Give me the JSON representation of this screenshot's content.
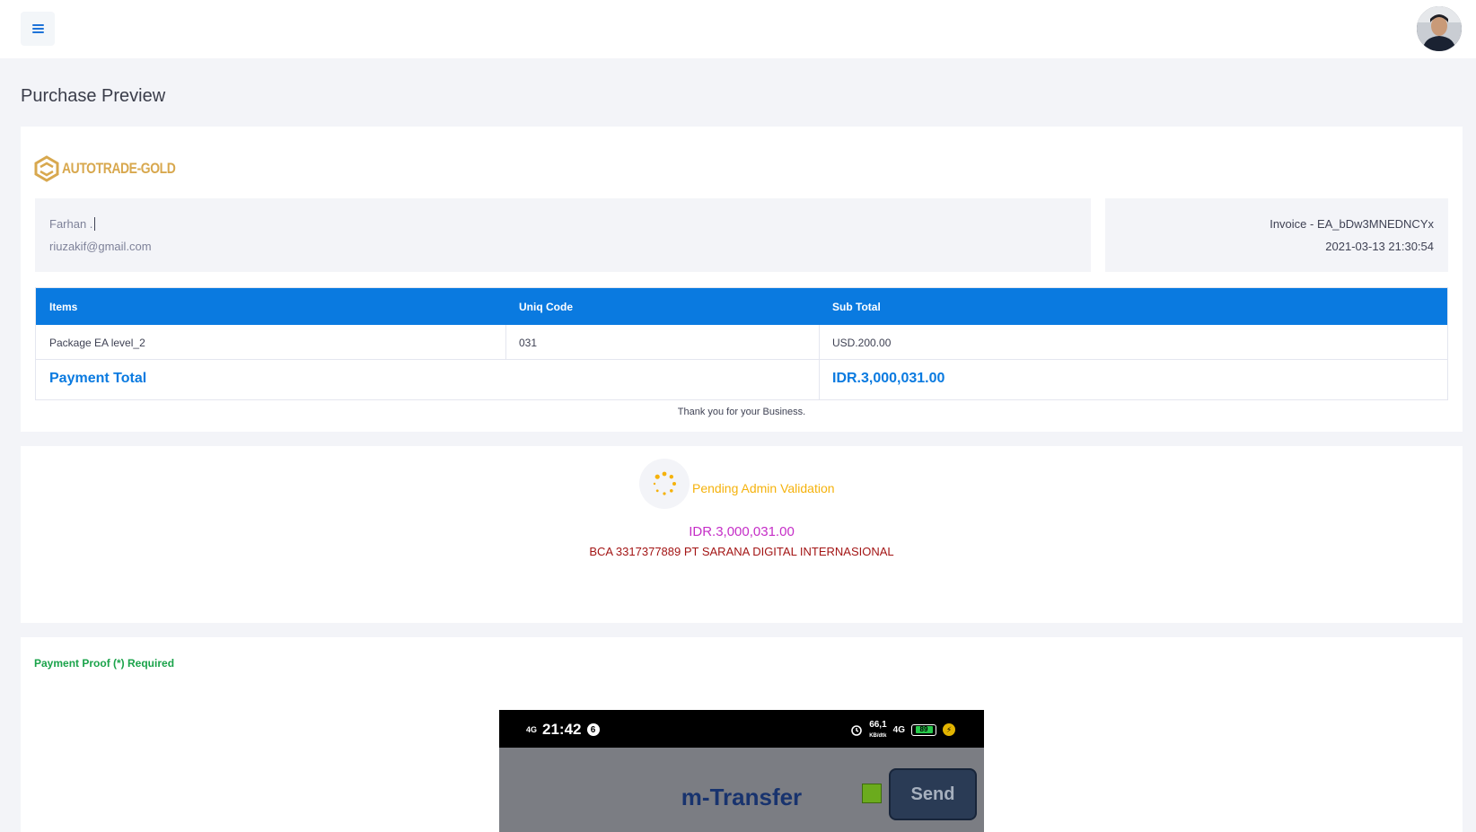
{
  "topbar": {
    "menu_icon": "hamburger-menu-icon",
    "avatar": "user-avatar-photo"
  },
  "page": {
    "title": "Purchase Preview"
  },
  "invoice": {
    "brand": {
      "name": "AUTOTRADE-GOLD",
      "color": "#d8a84e",
      "logo_icon": "hexagon-logo-icon"
    },
    "client": {
      "name": "Farhan .",
      "email": "riuzakif@gmail.com"
    },
    "meta": {
      "invoice_id": "Invoice - EA_bDw3MNEDNCYx",
      "datetime": "2021-03-13 21:30:54"
    },
    "table": {
      "headers": [
        "Items",
        "Uniq Code",
        "Sub Total"
      ],
      "rows": [
        [
          "Package EA level_2",
          "031",
          "USD.200.00"
        ]
      ],
      "total_label": "Payment Total",
      "total_value": "IDR.3,000,031.00",
      "header_color": "#0a7ae0"
    },
    "thanks": "Thank you for your Business."
  },
  "status": {
    "spinner_icon": "loading-spinner-icon",
    "label": "Pending Admin Validation",
    "label_color": "#f5b20c",
    "amount": "IDR.3,000,031.00",
    "amount_color": "#c52ec7",
    "bank_info": "BCA 3317377889 PT SARANA DIGITAL INTERNASIONAL",
    "bank_color": "#a31515"
  },
  "proof": {
    "label": "Payment Proof (*) Required",
    "label_color": "#1aa34a",
    "screenshot": {
      "signal": "4G",
      "time": "21:42",
      "badge": "6",
      "alarm_icon": "alarm-clock-icon",
      "speed": "66,1",
      "speed_unit": "KB/dtk",
      "network": "4G",
      "battery": "89",
      "charging_icon": "lightning-bolt-icon",
      "title": "m-Transfer",
      "send_label": "Send"
    }
  }
}
